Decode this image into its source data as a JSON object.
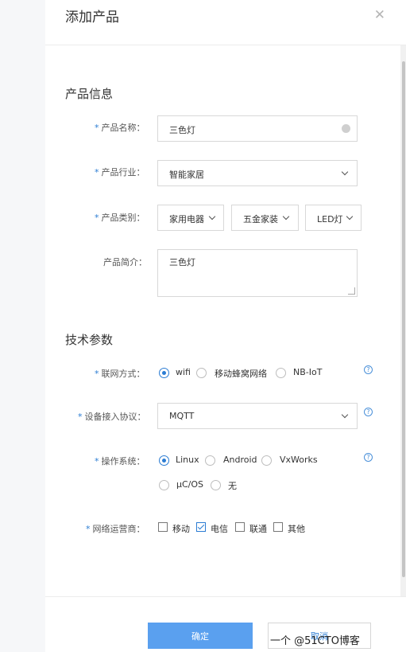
{
  "dialog": {
    "title": "添加产品",
    "close_icon": "close-icon"
  },
  "product_info": {
    "section_title": "产品信息",
    "name": {
      "label": "产品名称：",
      "value": "三色灯"
    },
    "industry": {
      "label": "产品行业：",
      "value": "智能家居"
    },
    "category": {
      "label": "产品类别：",
      "values": [
        "家用电器",
        "五金家装",
        "LED灯"
      ]
    },
    "description": {
      "label": "产品简介：",
      "value": "三色灯"
    }
  },
  "tech_params": {
    "section_title": "技术参数",
    "network": {
      "label": "联网方式：",
      "options": [
        "wifi",
        "移动蜂窝网络",
        "NB-IoT"
      ],
      "selected": "wifi"
    },
    "protocol": {
      "label": "设备接入协议：",
      "value": "MQTT"
    },
    "os": {
      "label": "操作系统：",
      "options": [
        "Linux",
        "Android",
        "VxWorks",
        "μC/OS",
        "无"
      ],
      "selected": "Linux"
    },
    "carrier": {
      "label": "网络运营商：",
      "options": [
        "移动",
        "电信",
        "联通",
        "其他"
      ],
      "checked": [
        "电信"
      ]
    }
  },
  "footer": {
    "confirm": "确定",
    "cancel": "取消",
    "watermark": "一个 @51CTO博客"
  },
  "colors": {
    "accent": "#2b7cd3",
    "primary_button": "#5aa0ef"
  }
}
